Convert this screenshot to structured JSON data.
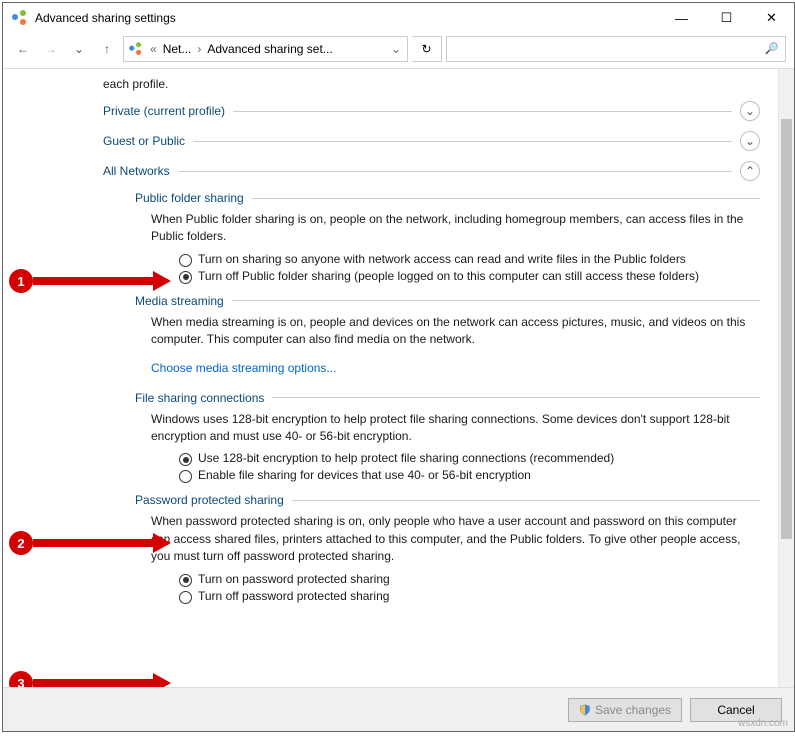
{
  "window": {
    "title": "Advanced sharing settings",
    "minimize_glyph": "—",
    "maximize_glyph": "☐",
    "close_glyph": "✕"
  },
  "toolbar": {
    "breadcrumbs": {
      "sep_left": "«",
      "part1": "Net...",
      "sep": "›",
      "part2": "Advanced sharing set..."
    },
    "dropdown_glyph": "⌄",
    "refresh_glyph": "↻",
    "search_glyph": "🔍",
    "back_glyph": "←",
    "forward_glyph": "→",
    "recent_glyph": "⌄",
    "up_glyph": "↑"
  },
  "content": {
    "each_profile": "each profile.",
    "profiles": {
      "private": {
        "label": "Private (current profile)",
        "expand": "⌄"
      },
      "guest": {
        "label": "Guest or Public",
        "expand": "⌄"
      },
      "all": {
        "label": "All Networks",
        "expand": "⌃"
      }
    },
    "public_folder": {
      "title": "Public folder sharing",
      "desc": "When Public folder sharing is on, people on the network, including homegroup members, can access files in the Public folders.",
      "opt_on": "Turn on sharing so anyone with network access can read and write files in the Public folders",
      "opt_off": "Turn off Public folder sharing (people logged on to this computer can still access these folders)"
    },
    "media": {
      "title": "Media streaming",
      "desc": "When media streaming is on, people and devices on the network can access pictures, music, and videos on this computer. This computer can also find media on the network.",
      "link": "Choose media streaming options..."
    },
    "fileconn": {
      "title": "File sharing connections",
      "desc": "Windows uses 128-bit encryption to help protect file sharing connections. Some devices don't support 128-bit encryption and must use 40- or 56-bit encryption.",
      "opt_128": "Use 128-bit encryption to help protect file sharing connections (recommended)",
      "opt_4056": "Enable file sharing for devices that use 40- or 56-bit encryption"
    },
    "password": {
      "title": "Password protected sharing",
      "desc": "When password protected sharing is on, only people who have a user account and password on this computer can access shared files, printers attached to this computer, and the Public folders. To give other people access, you must turn off password protected sharing.",
      "opt_on": "Turn on password protected sharing",
      "opt_off": "Turn off password protected sharing"
    }
  },
  "footer": {
    "save": "Save changes",
    "cancel": "Cancel"
  },
  "annotations": {
    "a1": "1",
    "a2": "2",
    "a3": "3"
  },
  "watermark": "wsxdn.com"
}
